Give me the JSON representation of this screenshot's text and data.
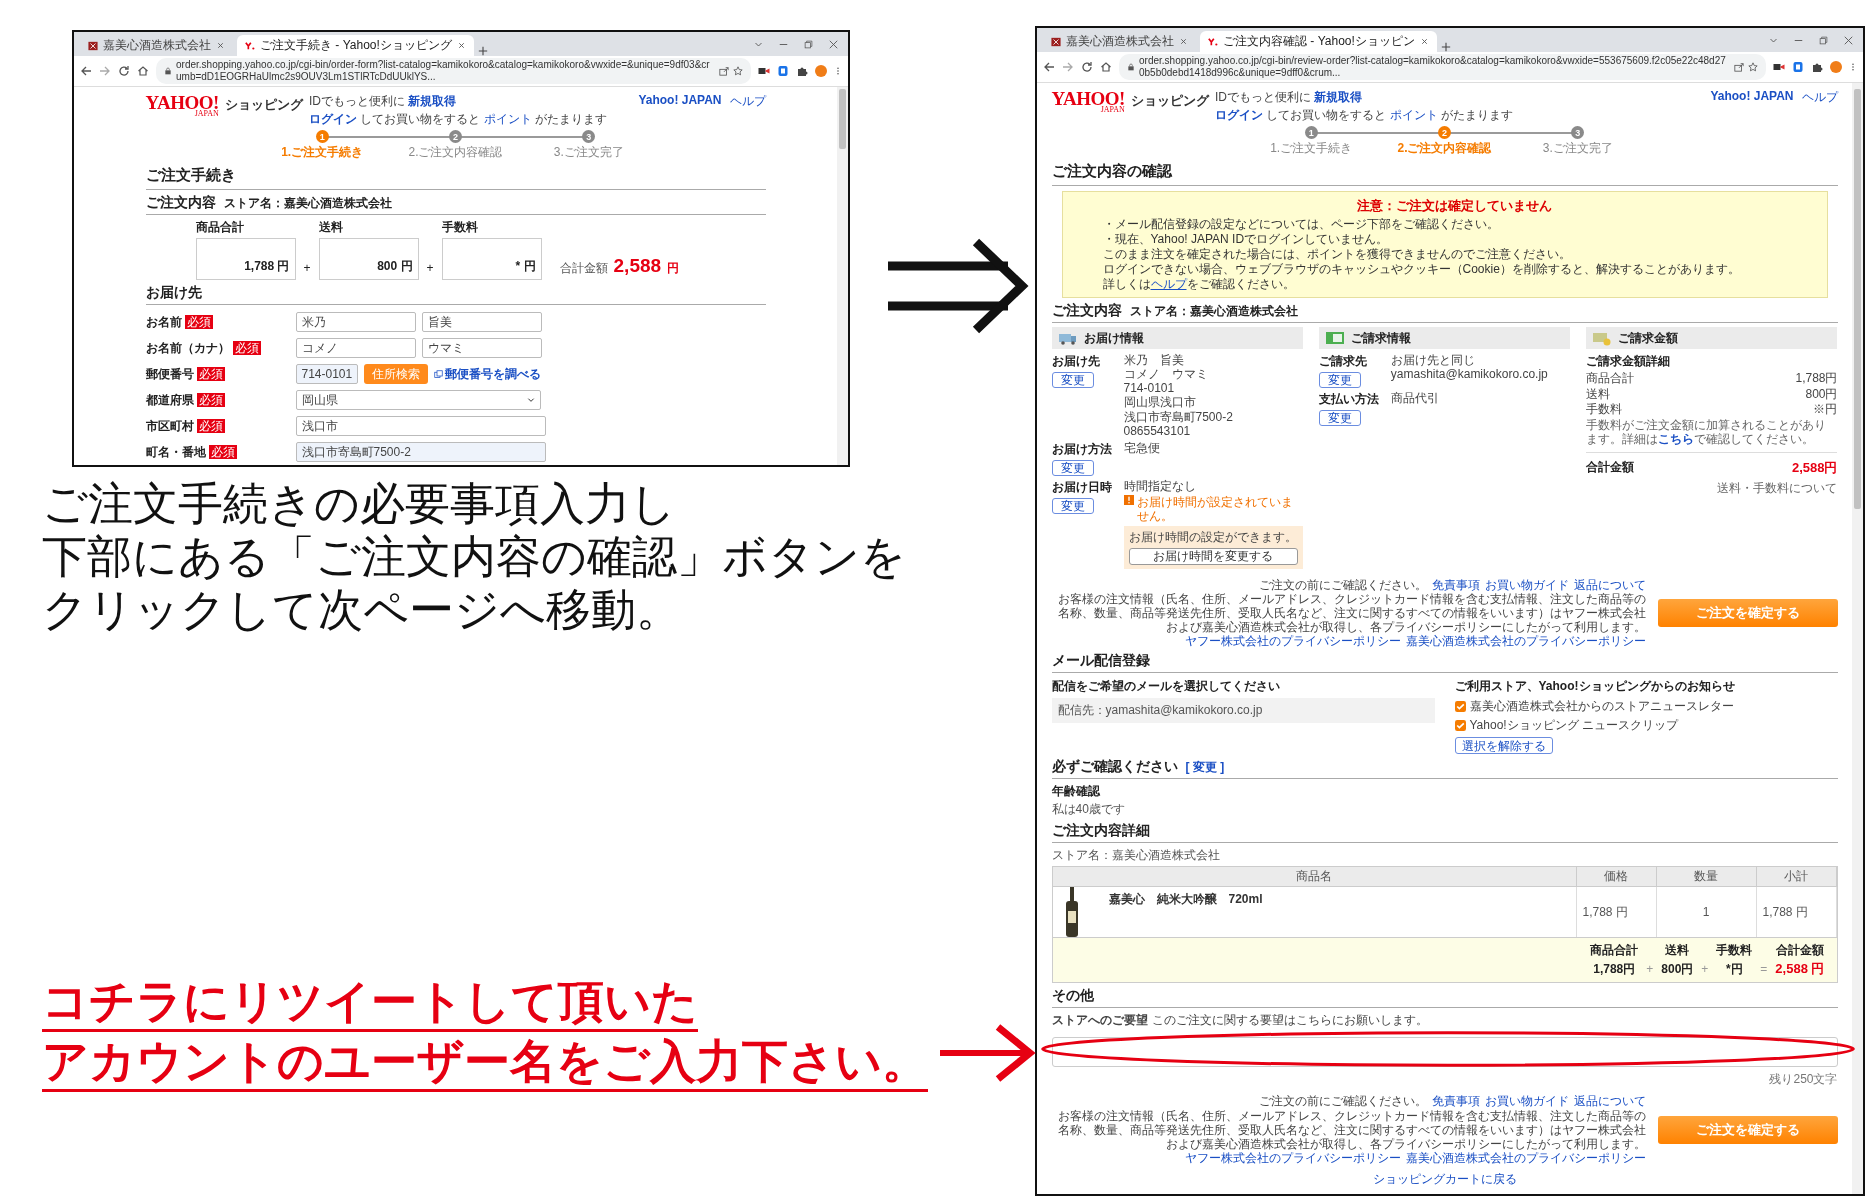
{
  "left_screen": {
    "browser": {
      "tabs": [
        {
          "title": "嘉美心酒造株式会社",
          "selected": false,
          "kind": "store"
        },
        {
          "title": "ご注文手続き - Yahoo!ショッピング",
          "selected": true,
          "kind": "yahoo"
        }
      ],
      "url": "order.shopping.yahoo.co.jp/cgi-bin/order-form?list-catalog=kamikokoro&catalog=kamikokoro&vwxide=&unique=9df03&crumb=dD1EOGRHaUlmc2s9OUV3Lm1STlRTcDdUUklYS..."
    },
    "header": {
      "logo": "YAHOO!",
      "logo_sub": "JAPAN",
      "service": "ショッピング",
      "line1": "IDでもっと便利に",
      "signup_link": "新規取得",
      "login_link": "ログイン",
      "line2_middle": "してお買い物をすると",
      "points_link": "ポイント",
      "line2_end": "がたまります",
      "top_link": "Yahoo! JAPAN",
      "help_link": "ヘルプ"
    },
    "steps": [
      {
        "number": "1",
        "label": "1.ご注文手続き",
        "selected": true
      },
      {
        "number": "2",
        "label": "2.ご注文内容確認",
        "selected": false
      },
      {
        "number": "3",
        "label": "3.ご注文完了",
        "selected": false
      }
    ],
    "title": "ご注文手続き",
    "order": {
      "heading": "ご注文内容",
      "store": "ストア名：嘉美心酒造株式会社",
      "boxes": [
        {
          "label": "商品合計",
          "amount": "1,788 円"
        },
        {
          "label": "送料",
          "amount": "800 円"
        },
        {
          "label": "手数料",
          "amount": "* 円"
        }
      ],
      "operators": [
        "+",
        "+"
      ],
      "total_label": "合計金額",
      "total_value": "2,588",
      "total_unit": "円"
    },
    "delivery": {
      "heading": "お届け先",
      "rows": [
        {
          "kind": "pair",
          "label": "お名前",
          "required": "必須",
          "values": [
            "米乃",
            "旨美"
          ]
        },
        {
          "kind": "pair",
          "label": "お名前（カナ）",
          "required": "必須",
          "values": [
            "コメノ",
            "ウマミ"
          ]
        },
        {
          "kind": "zip",
          "label": "郵便番号",
          "required": "必須",
          "values": [
            "714-0101"
          ],
          "button": "住所検索",
          "link": "郵便番号を調べる"
        },
        {
          "kind": "select",
          "label": "都道府県",
          "required": "必須",
          "values": [
            "岡山県"
          ]
        },
        {
          "kind": "text",
          "label": "市区町村",
          "required": "必須",
          "values": [
            "浅口市"
          ]
        },
        {
          "kind": "text",
          "label": "町名・番地",
          "required": "必須",
          "values": [
            "浅口市寄島町7500-2"
          ]
        }
      ]
    }
  },
  "instructions": [
    "ご注文手続きの必要事項入力し",
    "下部にある「ご注文内容の確認」ボタンを",
    "クリックして次ページへ移動。"
  ],
  "callout": [
    "コチラにリツイートして頂いた",
    "アカウントのユーザー名をご入力下さい。"
  ],
  "right_screen": {
    "browser": {
      "tabs": [
        {
          "title": "嘉美心酒造株式会社",
          "selected": false,
          "kind": "store"
        },
        {
          "title": "ご注文内容確認 - Yahoo!ショッピン",
          "selected": true,
          "kind": "yahoo"
        }
      ],
      "url": "order.shopping.yahoo.co.jp/cgi-bin/review-order?list-catalog=kamikokoro&catalog=kamikokoro&vwxide=553675609.f2c05e22c48d270b5b0debd1418d996c&unique=9dff0&crum..."
    },
    "header": {
      "logo": "YAHOO!",
      "logo_sub": "JAPAN",
      "service": "ショッピング",
      "line1": "IDでもっと便利に",
      "signup_link": "新規取得",
      "login_link": "ログイン",
      "line2_middle": "してお買い物をすると",
      "points_link": "ポイント",
      "line2_end": "がたまります",
      "top_link": "Yahoo! JAPAN",
      "help_link": "ヘルプ"
    },
    "steps": [
      {
        "number": "1",
        "label": "1.ご注文手続き",
        "selected": false
      },
      {
        "number": "2",
        "label": "2.ご注文内容確認",
        "selected": true
      },
      {
        "number": "3",
        "label": "3.ご注文完了",
        "selected": false
      }
    ],
    "title": "ご注文内容の確認",
    "notice": {
      "title": "注意：ご注文は確定していません",
      "lines": [
        "・メール配信登録の設定などについては、ページ下部をご確認ください。",
        "・現在、Yahoo! JAPAN IDでログインしていません。",
        "このまま注文を確定された場合には、ポイントを獲得できませんのでご注意ください。",
        "ログインできない場合、ウェブブラウザのキャッシュやクッキー（Cookie）を削除すると、解決することがあります。"
      ],
      "help_before": "詳しくは",
      "help_link": "ヘルプ",
      "help_after": "をご確認ください。"
    },
    "order": {
      "heading": "ご注文内容",
      "store": "ストア名：嘉美心酒造株式会社",
      "delivery_info": {
        "title": "お届け情報",
        "rows": [
          {
            "label": "お届け先",
            "button": "変更",
            "lines": [
              "米乃　旨美",
              "コメノ　ウマミ",
              "714-0101",
              "岡山県浅口市",
              "浅口市寄島町7500-2",
              "0865543101"
            ]
          },
          {
            "label": "お届け方法",
            "button": "変更",
            "lines": [
              "宅急便"
            ]
          },
          {
            "label": "お届け日時",
            "button": "変更",
            "lines": [
              "時間指定なし"
            ],
            "warning": "お届け時間が設定されていません。",
            "time_note": "お届け時間の設定ができます。",
            "time_button": "お届け時間を変更する"
          }
        ]
      },
      "billing_info": {
        "title": "ご請求情報",
        "rows": [
          {
            "label": "ご請求先",
            "button": "変更",
            "lines": [
              "お届け先と同じ",
              "yamashita@kamikokoro.co.jp"
            ]
          },
          {
            "label": "支払い方法",
            "button": "変更",
            "lines": [
              "商品代引"
            ]
          }
        ]
      },
      "billing_amount": {
        "title": "ご請求金額",
        "subtitle": "ご請求金額詳細",
        "rows": [
          {
            "label": "商品合計",
            "value": "1,788円"
          },
          {
            "label": "送料",
            "value": "800円"
          },
          {
            "label": "手数料",
            "value": "※円"
          }
        ],
        "note_before": "手数料がご注文金額に加算されることがあります。詳細は",
        "note_link": "こちら",
        "note_after": "で確認してください。",
        "total_label": "合計金額",
        "total_value": "2,588円",
        "fees_link": "送料・手数料について"
      }
    },
    "consent_top": {
      "intro": "ご注文の前にご確認ください。",
      "links": [
        "免責事項",
        "お買い物ガイド",
        "返品について"
      ],
      "body": "お客様の注文情報（氏名、住所、メールアドレス、クレジットカード情報を含む支払情報、注文した商品等の名称、数量、商品等発送先住所、受取人氏名など、注文に関するすべての情報をいいます）はヤフー株式会社および嘉美心酒造株式会社が取得し、各プライバシーポリシーにしたがって利用します。",
      "policy_links": [
        "ヤフー株式会社のプライバシーポリシー",
        "嘉美心酒造株式会社のプライバシーポリシー"
      ],
      "button": "ご注文を確定する"
    },
    "mail": {
      "heading": "メール配信登録",
      "prompt": "配信をご希望のメールを選択してください",
      "address": "配信先：yamashita@kamikokoro.co.jp",
      "options_title": "ご利用ストア、Yahoo!ショッピングからのお知らせ",
      "options": [
        {
          "label": "嘉美心酒造株式会社からのストアニュースレター",
          "checked": true
        },
        {
          "label": "Yahoo!ショッピング ニュースクリップ",
          "checked": true
        }
      ],
      "clear_button": "選択を解除する"
    },
    "confirm": {
      "heading": "必ずご確認ください",
      "change_link": "[ 変更 ]",
      "item_title": "年齢確認",
      "item_value": "私は40歳です"
    },
    "details": {
      "heading": "ご注文内容詳細",
      "store": "ストア名：嘉美心酒造株式会社",
      "columns": [
        "商品名",
        "価格",
        "数量",
        "小計"
      ],
      "rows": [
        {
          "name": "嘉美心　純米大吟醸　720ml",
          "price": "1,788 円",
          "quantity": "1",
          "subtotal": "1,788 円"
        }
      ],
      "summary_labels": [
        "商品合計",
        "送料",
        "手数料",
        "合計金額"
      ],
      "summary_values": [
        "1,788円",
        "800円",
        "*円",
        "2,588 円"
      ],
      "summary_operators": [
        "+",
        "+",
        "="
      ]
    },
    "other": {
      "heading": "その他",
      "request_label": "ストアへのご要望",
      "request_hint": "このご注文に関する要望はこちらにお願いします。",
      "remaining": "残り250文字"
    },
    "consent_bottom": {
      "intro": "ご注文の前にご確認ください。",
      "links": [
        "免責事項",
        "お買い物ガイド",
        "返品について"
      ],
      "body": "お客様の注文情報（氏名、住所、メールアドレス、クレジットカード情報を含む支払情報、注文した商品等の名称、数量、商品等発送先住所、受取人氏名など、注文に関するすべての情報をいいます）はヤフー株式会社および嘉美心酒造株式会社が取得し、各プライバシーポリシーにしたがって利用します。",
      "policy_links": [
        "ヤフー株式会社のプライバシーポリシー",
        "嘉美心酒造株式会社のプライバシーポリシー"
      ],
      "button": "ご注文を確定する"
    },
    "back_link": "ショッピングカートに戻る"
  }
}
